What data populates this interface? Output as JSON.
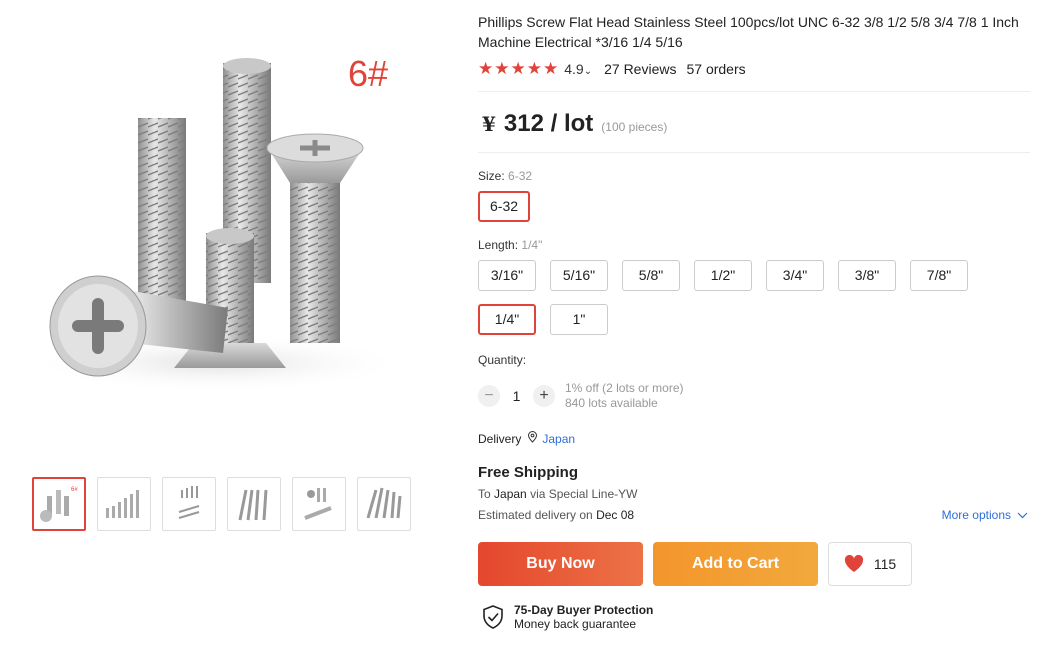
{
  "gallery": {
    "main_badge": "6#",
    "thumbnail_count": 6
  },
  "product": {
    "title": "Phillips Screw Flat Head Stainless Steel 100pcs/lot UNC 6-32 3/8 1/2 5/8 3/4 7/8 1 Inch Machine Electrical *3/16 1/4 5/16",
    "rating": "4.9",
    "stars": 5,
    "reviews": "27 Reviews",
    "orders": "57 orders"
  },
  "price": {
    "currency": "¥",
    "amount": "312 / lot",
    "note": "(100 pieces)"
  },
  "size": {
    "label": "Size:",
    "selected": "6-32",
    "options": [
      "6-32"
    ]
  },
  "length": {
    "label": "Length:",
    "selected": "1/4\"",
    "options": [
      "3/16\"",
      "5/16\"",
      "5/8\"",
      "1/2\"",
      "3/4\"",
      "3/8\"",
      "7/8\"",
      "1/4\"",
      "1\""
    ]
  },
  "quantity": {
    "label": "Quantity:",
    "minus": "−",
    "value": "1",
    "plus": "+",
    "discount": "1% off (2 lots or more)",
    "available": "840 lots available"
  },
  "delivery": {
    "label": "Delivery",
    "country": "Japan"
  },
  "shipping": {
    "title": "Free Shipping",
    "to": "To",
    "country": "Japan",
    "via": "via Special Line-YW",
    "estimated": "Estimated delivery on",
    "date": "Dec 08",
    "more_options": "More options"
  },
  "actions": {
    "buy_now": "Buy Now",
    "add_to_cart": "Add to Cart",
    "wishlist_count": "115"
  },
  "protection": {
    "title": "75-Day Buyer Protection",
    "subtitle": "Money back guarantee"
  },
  "colors": {
    "accent_red": "#e0433a",
    "buy_now": "#e4472d",
    "add_to_cart": "#f3952c",
    "link_blue": "#2e6fd8"
  }
}
